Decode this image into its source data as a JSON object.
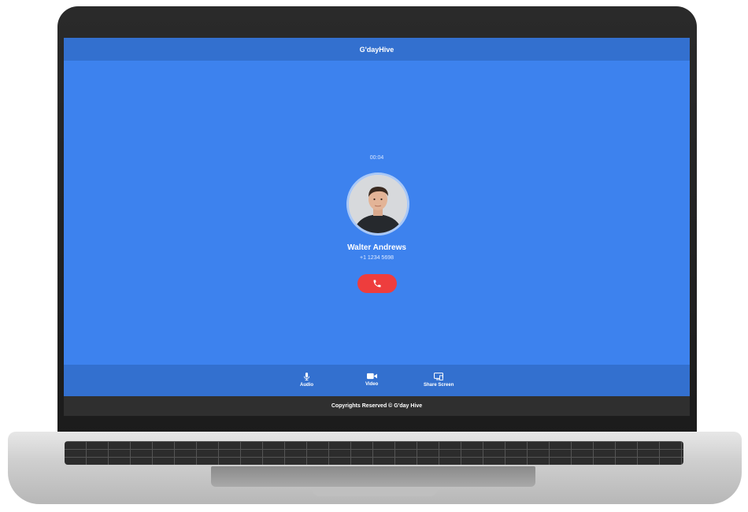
{
  "app": {
    "title": "G'dayHive"
  },
  "call": {
    "timer": "00:04",
    "caller_name": "Walter Andrews",
    "caller_number": "+1 1234 5698"
  },
  "controls": [
    {
      "label": "Audio",
      "icon": "microphone-icon"
    },
    {
      "label": "Video",
      "icon": "video-camera-icon"
    },
    {
      "label": "Share Screen",
      "icon": "share-screen-icon"
    }
  ],
  "footer": {
    "text": "Copyrights Reserved © G'day Hive"
  },
  "colors": {
    "screen_bg": "#3d82ee",
    "bar_bg": "#3370cf",
    "hangup": "#ee3d3d",
    "footer_bg": "#2f2f2f"
  }
}
